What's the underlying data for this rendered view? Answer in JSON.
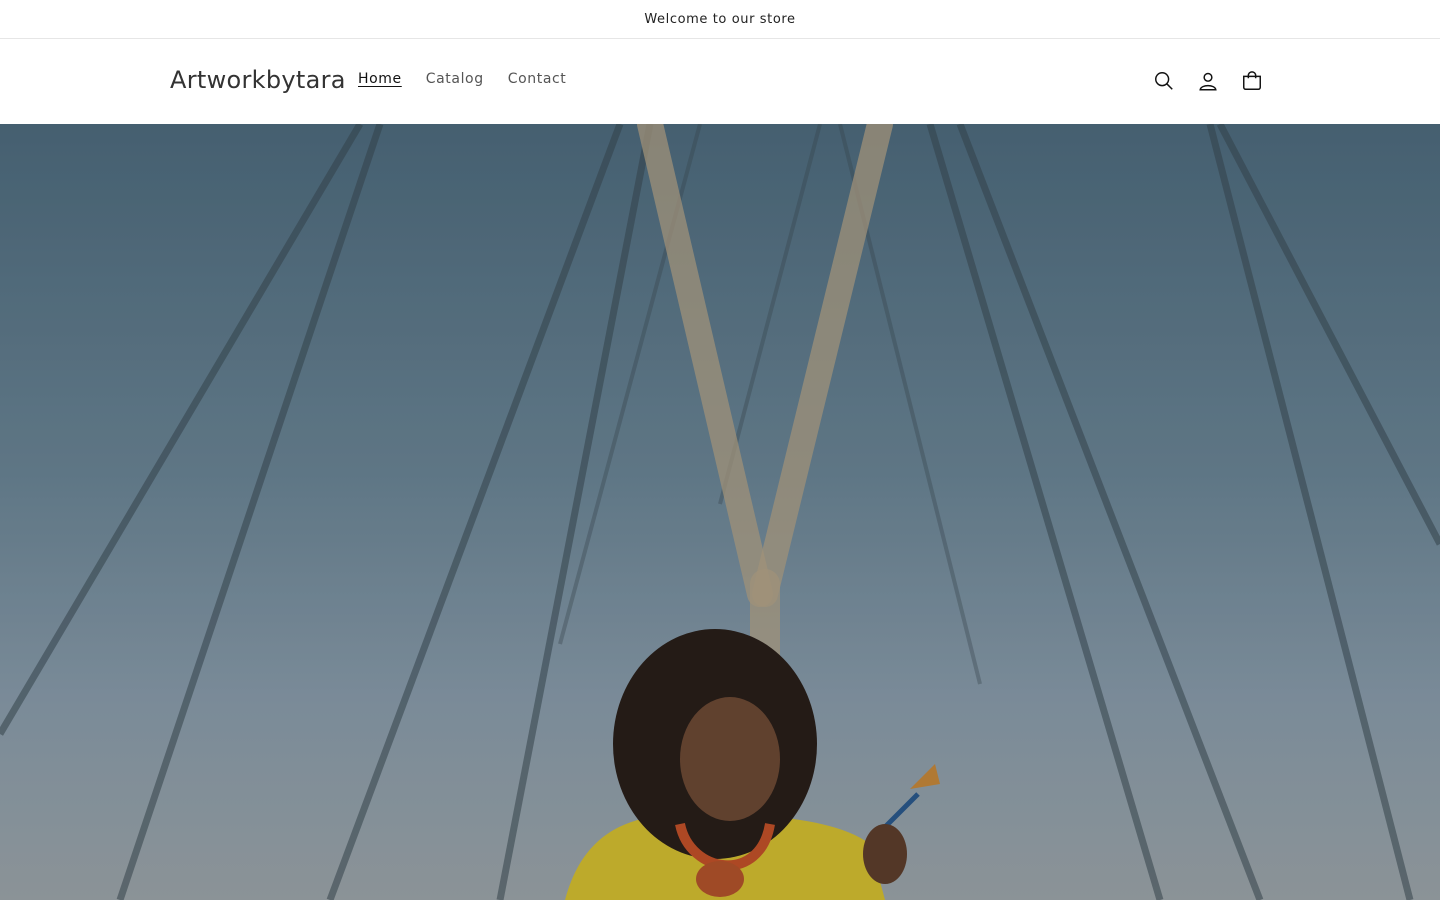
{
  "announcement": {
    "text": "Welcome to our store"
  },
  "header": {
    "brand": "Artworkbytara",
    "nav": [
      {
        "label": "Home",
        "active": true
      },
      {
        "label": "Catalog",
        "active": false
      },
      {
        "label": "Contact",
        "active": false
      }
    ],
    "icons": [
      "search-icon",
      "account-icon",
      "cart-icon"
    ]
  },
  "hero": {
    "image": "photo of a woman in a yellow top holding a paintbrush beneath cable-stayed bridge cables against a blue sky"
  },
  "colors": {
    "text": "#121212",
    "border": "#e6e6e6",
    "sky_top": "#4f6d80",
    "sky_bottom": "#9fa8ac",
    "shirt": "#d8c232"
  }
}
